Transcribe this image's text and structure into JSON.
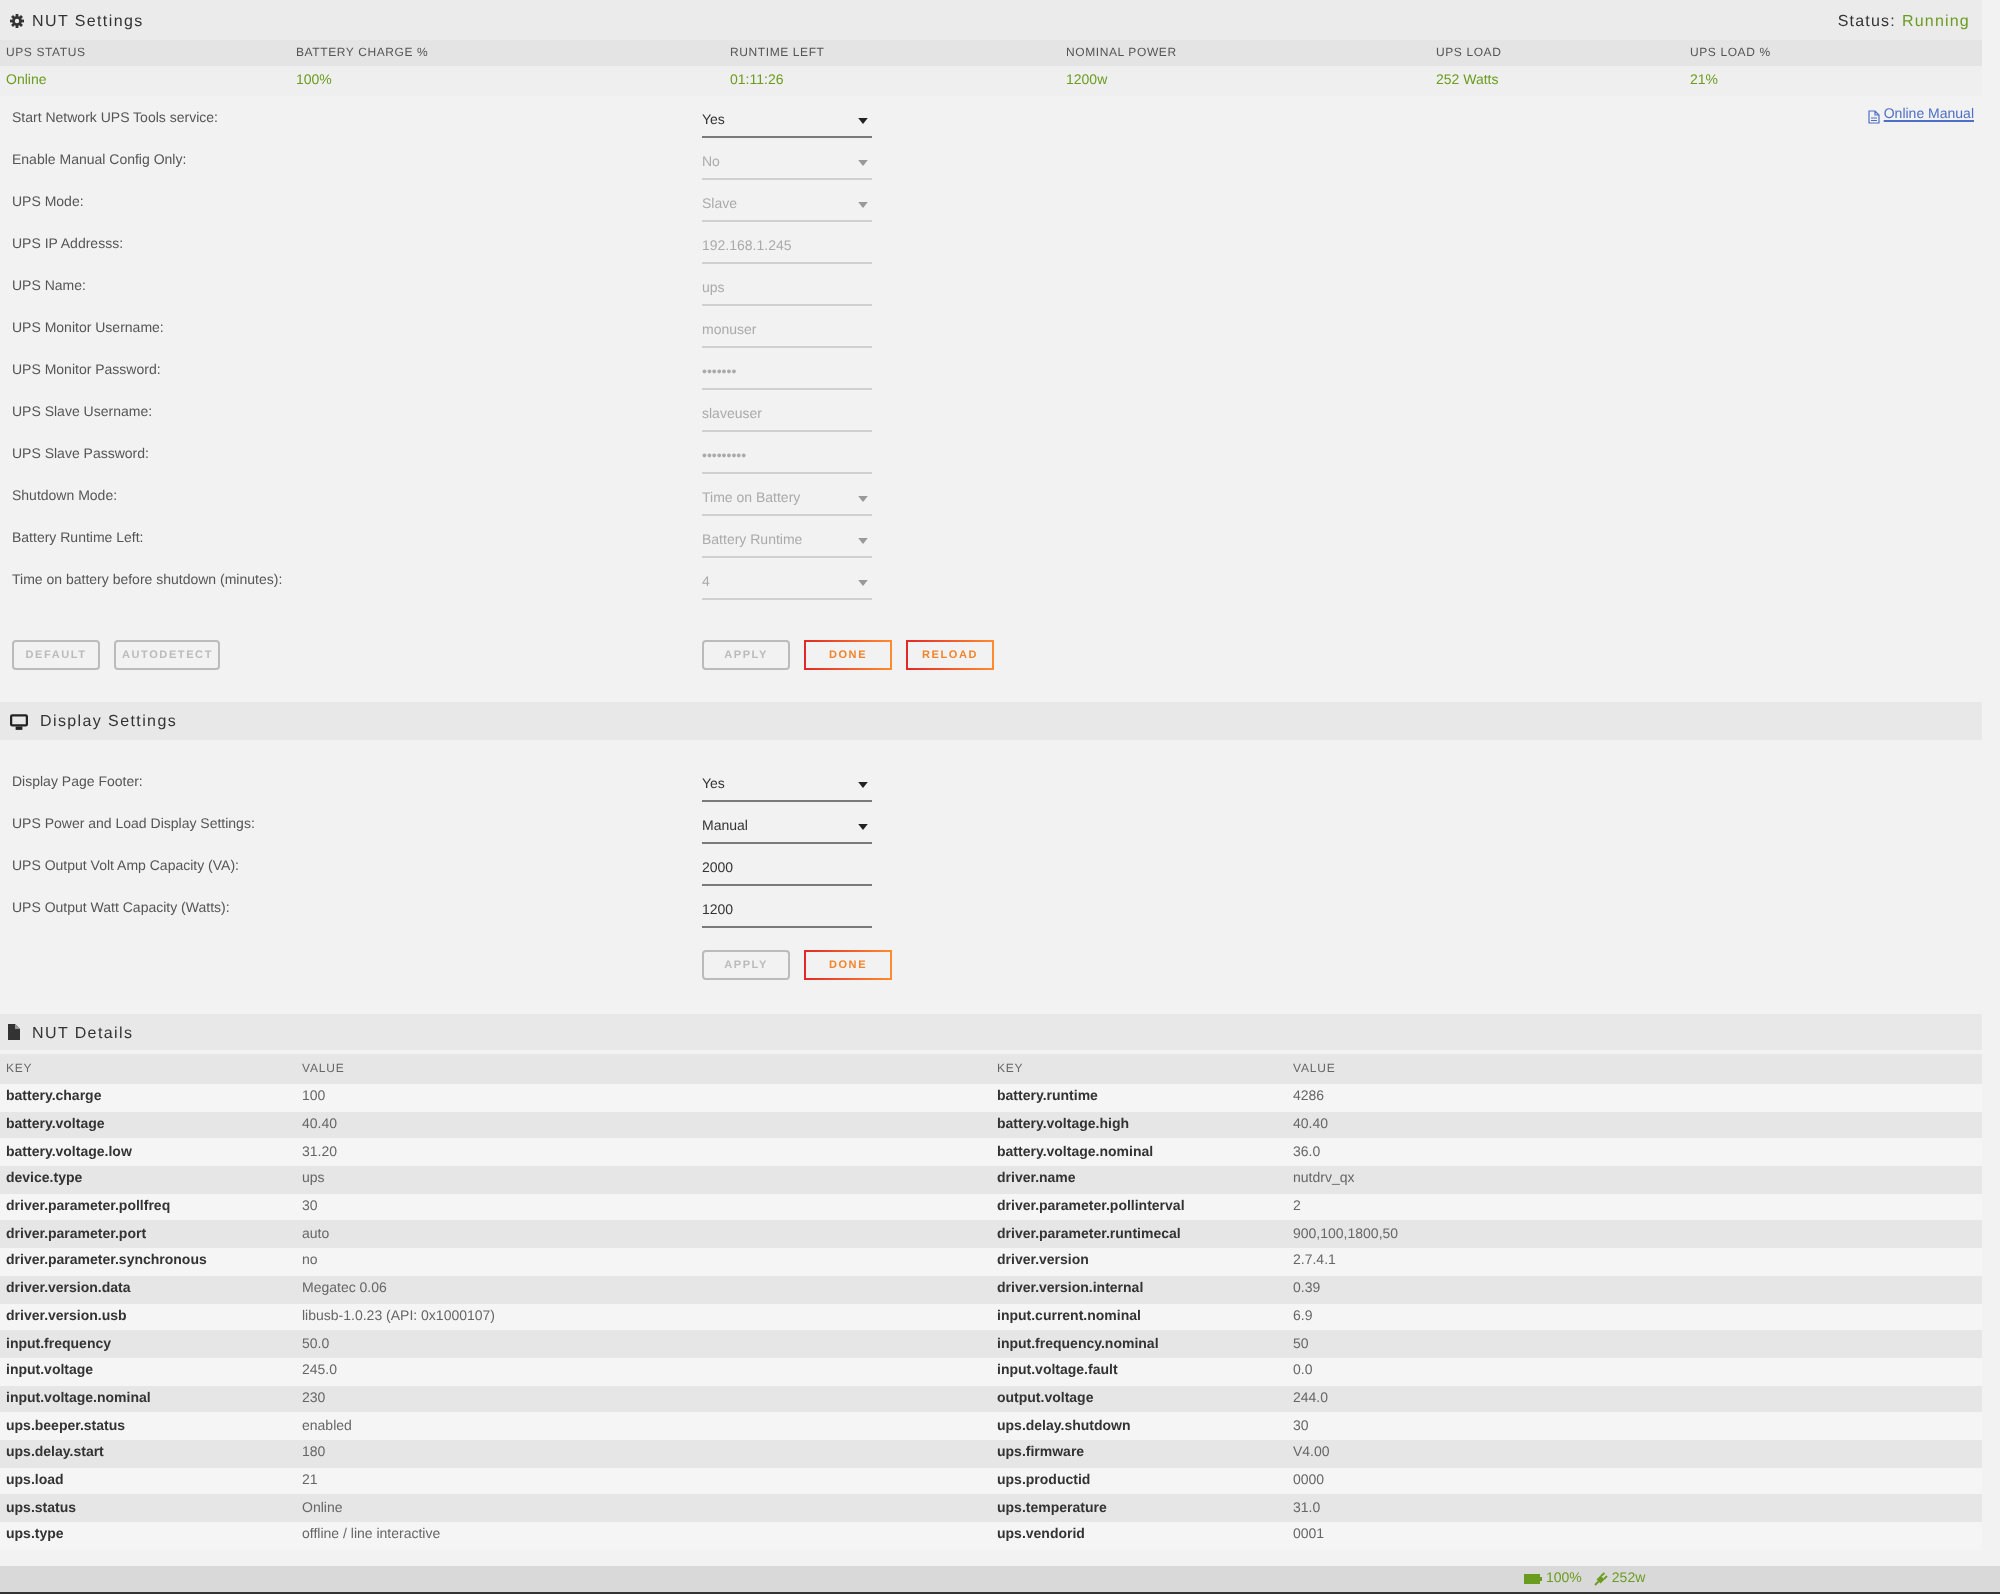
{
  "header": {
    "title": "NUT Settings",
    "status_label": "Status:",
    "status_value": "Running"
  },
  "summary": {
    "columns": [
      "UPS STATUS",
      "BATTERY CHARGE %",
      "RUNTIME LEFT",
      "NOMINAL POWER",
      "UPS LOAD",
      "UPS LOAD %"
    ],
    "values": [
      "Online",
      "100%",
      "01:11:26",
      "1200w",
      "252 Watts",
      "21%"
    ]
  },
  "settings": {
    "link": "Online Manual",
    "fields": [
      {
        "label": "Start Network UPS Tools service:",
        "kind": "select",
        "value": "Yes",
        "disabled": false
      },
      {
        "label": "Enable Manual Config Only:",
        "kind": "select",
        "value": "No",
        "disabled": true
      },
      {
        "label": "UPS Mode:",
        "kind": "select",
        "value": "Slave",
        "disabled": true
      },
      {
        "label": "UPS IP Addresss:",
        "kind": "text",
        "value": "192.168.1.245",
        "disabled": true
      },
      {
        "label": "UPS Name:",
        "kind": "text",
        "value": "ups",
        "disabled": true
      },
      {
        "label": "UPS Monitor Username:",
        "kind": "text",
        "value": "monuser",
        "disabled": true
      },
      {
        "label": "UPS Monitor Password:",
        "kind": "text",
        "value": "•••••••",
        "disabled": true
      },
      {
        "label": "UPS Slave Username:",
        "kind": "text",
        "value": "slaveuser",
        "disabled": true
      },
      {
        "label": "UPS Slave Password:",
        "kind": "text",
        "value": "•••••••••",
        "disabled": true
      },
      {
        "label": "Shutdown Mode:",
        "kind": "select",
        "value": "Time on Battery",
        "disabled": true
      },
      {
        "label": "Battery Runtime Left:",
        "kind": "select",
        "value": "Battery Runtime",
        "disabled": true
      },
      {
        "label": "Time on battery before shutdown (minutes):",
        "kind": "select",
        "value": "4",
        "disabled": true
      }
    ],
    "left_buttons": [
      {
        "label": "DEFAULT",
        "disabled": true
      },
      {
        "label": "AUTODETECT",
        "disabled": true
      }
    ],
    "right_buttons": [
      {
        "label": "APPLY",
        "disabled": true
      },
      {
        "label": "DONE",
        "disabled": false
      },
      {
        "label": "RELOAD",
        "disabled": false
      }
    ]
  },
  "display_settings": {
    "title": "Display Settings",
    "fields": [
      {
        "label": "Display Page Footer:",
        "kind": "select",
        "value": "Yes",
        "disabled": false
      },
      {
        "label": "UPS Power and Load Display Settings:",
        "kind": "select",
        "value": "Manual",
        "disabled": false
      },
      {
        "label": "UPS Output Volt Amp Capacity (VA):",
        "kind": "text",
        "value": "2000",
        "disabled": false
      },
      {
        "label": "UPS Output Watt Capacity (Watts):",
        "kind": "text",
        "value": "1200",
        "disabled": false
      }
    ],
    "right_buttons": [
      {
        "label": "APPLY",
        "disabled": true
      },
      {
        "label": "DONE",
        "disabled": false
      }
    ]
  },
  "nut_details": {
    "title": "NUT Details",
    "tables": [
      {
        "columns": [
          "KEY",
          "VALUE"
        ],
        "rows": [
          {
            "key": "battery.charge",
            "value": "100"
          },
          {
            "key": "battery.voltage",
            "value": "40.40"
          },
          {
            "key": "battery.voltage.low",
            "value": "31.20"
          },
          {
            "key": "device.type",
            "value": "ups"
          },
          {
            "key": "driver.parameter.pollfreq",
            "value": "30"
          },
          {
            "key": "driver.parameter.port",
            "value": "auto"
          },
          {
            "key": "driver.parameter.synchronous",
            "value": "no"
          },
          {
            "key": "driver.version.data",
            "value": "Megatec 0.06"
          },
          {
            "key": "driver.version.usb",
            "value": "libusb-1.0.23 (API: 0x1000107)"
          },
          {
            "key": "input.frequency",
            "value": "50.0"
          },
          {
            "key": "input.voltage",
            "value": "245.0"
          },
          {
            "key": "input.voltage.nominal",
            "value": "230"
          },
          {
            "key": "ups.beeper.status",
            "value": "enabled"
          },
          {
            "key": "ups.delay.start",
            "value": "180"
          },
          {
            "key": "ups.load",
            "value": "21"
          },
          {
            "key": "ups.status",
            "value": "Online"
          },
          {
            "key": "ups.type",
            "value": "offline / line interactive"
          }
        ]
      },
      {
        "columns": [
          "KEY",
          "VALUE"
        ],
        "rows": [
          {
            "key": "battery.runtime",
            "value": "4286"
          },
          {
            "key": "battery.voltage.high",
            "value": "40.40"
          },
          {
            "key": "battery.voltage.nominal",
            "value": "36.0"
          },
          {
            "key": "driver.name",
            "value": "nutdrv_qx"
          },
          {
            "key": "driver.parameter.pollinterval",
            "value": "2"
          },
          {
            "key": "driver.parameter.runtimecal",
            "value": "900,100,1800,50"
          },
          {
            "key": "driver.version",
            "value": "2.7.4.1"
          },
          {
            "key": "driver.version.internal",
            "value": "0.39"
          },
          {
            "key": "input.current.nominal",
            "value": "6.9"
          },
          {
            "key": "input.frequency.nominal",
            "value": "50"
          },
          {
            "key": "input.voltage.fault",
            "value": "0.0"
          },
          {
            "key": "output.voltage",
            "value": "244.0"
          },
          {
            "key": "ups.delay.shutdown",
            "value": "30"
          },
          {
            "key": "ups.firmware",
            "value": "V4.00"
          },
          {
            "key": "ups.productid",
            "value": "0000"
          },
          {
            "key": "ups.temperature",
            "value": "31.0"
          },
          {
            "key": "ups.vendorid",
            "value": "0001"
          }
        ]
      }
    ]
  },
  "footer": {
    "battery": "100%",
    "power": "252w"
  }
}
